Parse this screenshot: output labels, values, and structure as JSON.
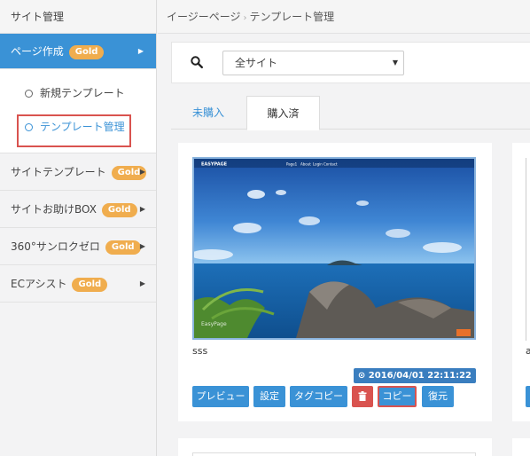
{
  "sidebar": {
    "header": "サイト管理",
    "items": [
      {
        "label": "ページ作成",
        "badge": "Gold",
        "active": true
      },
      {
        "label": "サイトテンプレート",
        "badge": "Gold"
      },
      {
        "label": "サイトお助けBOX",
        "badge": "Gold"
      },
      {
        "label": "360°サンロクゼロ",
        "badge": "Gold"
      },
      {
        "label": "ECアシスト",
        "badge": "Gold"
      }
    ],
    "submenu": [
      {
        "label": "新規テンプレート"
      },
      {
        "label": "テンプレート管理",
        "current": true
      }
    ],
    "arrow": "▶"
  },
  "breadcrumb": {
    "root": "イージーページ",
    "separator": "›",
    "current": "テンプレート管理"
  },
  "search": {
    "icon": "search-icon",
    "select_value": "全サイト",
    "caret": "▼"
  },
  "tabs": [
    {
      "label": "未購入"
    },
    {
      "label": "購入済",
      "active": true
    }
  ],
  "card": {
    "thumbnail": {
      "site_name": "EASYPAGE",
      "nav": [
        "Page1",
        "About",
        "Login",
        "Contact"
      ],
      "watermark": "EasyPage"
    },
    "title": "sss",
    "timestamp": "2016/04/01 22:11:22",
    "buttons": {
      "preview": "プレビュー",
      "settings": "設定",
      "tag_copy": "タグコピー",
      "delete_icon": "trash-icon",
      "copy": "コピー",
      "restore": "復元"
    }
  },
  "side_card": {
    "title_fragment": "a"
  },
  "colors": {
    "primary": "#3a92d6",
    "gold": "#f0ad4e",
    "danger": "#d9534f"
  }
}
